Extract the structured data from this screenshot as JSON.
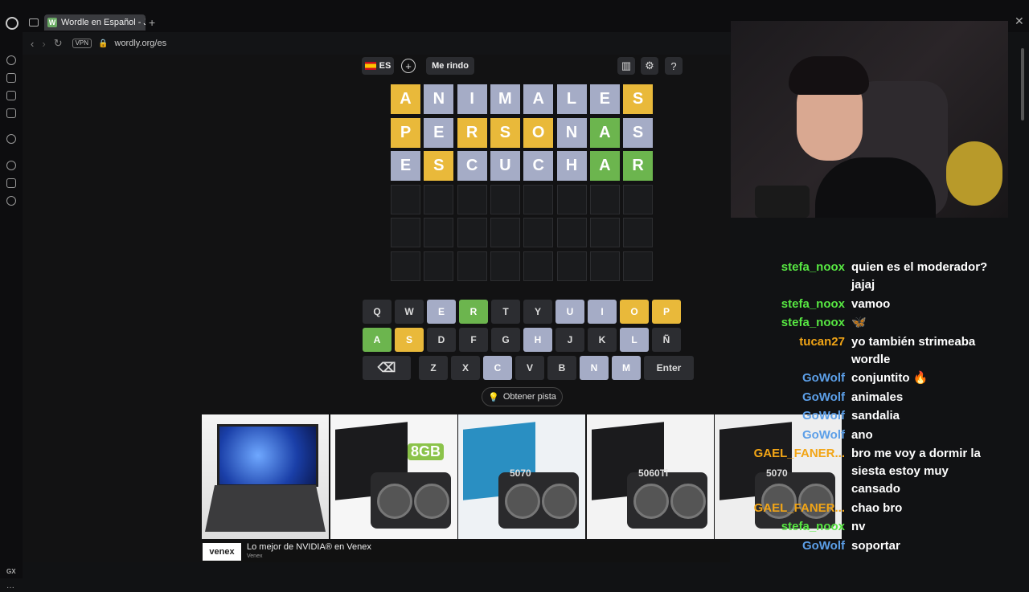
{
  "browser": {
    "tab_title": "Wordle en Español - Juego",
    "tab_favicon": "W",
    "url": "wordly.org/es",
    "vpn": "VPN",
    "sidebar_gx": "GX"
  },
  "header": {
    "language": "ES",
    "give_up": "Me rindo"
  },
  "colors": {
    "present": "#e9b93a",
    "correct": "#6cb54e",
    "absent": "#a5acc6"
  },
  "board": [
    [
      {
        "l": "A",
        "s": "present"
      },
      {
        "l": "N",
        "s": "absent"
      },
      {
        "l": "I",
        "s": "absent"
      },
      {
        "l": "M",
        "s": "absent"
      },
      {
        "l": "A",
        "s": "absent"
      },
      {
        "l": "L",
        "s": "absent"
      },
      {
        "l": "E",
        "s": "absent"
      },
      {
        "l": "S",
        "s": "present"
      }
    ],
    [
      {
        "l": "P",
        "s": "present"
      },
      {
        "l": "E",
        "s": "absent"
      },
      {
        "l": "R",
        "s": "present"
      },
      {
        "l": "S",
        "s": "present"
      },
      {
        "l": "O",
        "s": "present"
      },
      {
        "l": "N",
        "s": "absent"
      },
      {
        "l": "A",
        "s": "correct"
      },
      {
        "l": "S",
        "s": "absent"
      }
    ],
    [
      {
        "l": "E",
        "s": "absent"
      },
      {
        "l": "S",
        "s": "present"
      },
      {
        "l": "C",
        "s": "absent"
      },
      {
        "l": "U",
        "s": "absent"
      },
      {
        "l": "C",
        "s": "absent"
      },
      {
        "l": "H",
        "s": "absent"
      },
      {
        "l": "A",
        "s": "correct"
      },
      {
        "l": "R",
        "s": "correct"
      }
    ],
    [
      {
        "l": "",
        "s": "empty"
      },
      {
        "l": "",
        "s": "empty"
      },
      {
        "l": "",
        "s": "empty"
      },
      {
        "l": "",
        "s": "empty"
      },
      {
        "l": "",
        "s": "empty"
      },
      {
        "l": "",
        "s": "empty"
      },
      {
        "l": "",
        "s": "empty"
      },
      {
        "l": "",
        "s": "empty"
      }
    ],
    [
      {
        "l": "",
        "s": "empty"
      },
      {
        "l": "",
        "s": "empty"
      },
      {
        "l": "",
        "s": "empty"
      },
      {
        "l": "",
        "s": "empty"
      },
      {
        "l": "",
        "s": "empty"
      },
      {
        "l": "",
        "s": "empty"
      },
      {
        "l": "",
        "s": "empty"
      },
      {
        "l": "",
        "s": "empty"
      }
    ],
    [
      {
        "l": "",
        "s": "empty"
      },
      {
        "l": "",
        "s": "empty"
      },
      {
        "l": "",
        "s": "empty"
      },
      {
        "l": "",
        "s": "empty"
      },
      {
        "l": "",
        "s": "empty"
      },
      {
        "l": "",
        "s": "empty"
      },
      {
        "l": "",
        "s": "empty"
      },
      {
        "l": "",
        "s": "empty"
      }
    ]
  ],
  "keyboard": [
    [
      {
        "k": "Q",
        "s": ""
      },
      {
        "k": "W",
        "s": ""
      },
      {
        "k": "E",
        "s": "absent"
      },
      {
        "k": "R",
        "s": "correct"
      },
      {
        "k": "T",
        "s": ""
      },
      {
        "k": "Y",
        "s": ""
      },
      {
        "k": "U",
        "s": "absent"
      },
      {
        "k": "I",
        "s": "absent"
      },
      {
        "k": "O",
        "s": "present"
      },
      {
        "k": "P",
        "s": "present"
      }
    ],
    [
      {
        "k": "A",
        "s": "correct"
      },
      {
        "k": "S",
        "s": "present"
      },
      {
        "k": "D",
        "s": ""
      },
      {
        "k": "F",
        "s": ""
      },
      {
        "k": "G",
        "s": ""
      },
      {
        "k": "H",
        "s": "absent"
      },
      {
        "k": "J",
        "s": ""
      },
      {
        "k": "K",
        "s": ""
      },
      {
        "k": "L",
        "s": "absent"
      },
      {
        "k": "Ñ",
        "s": ""
      }
    ],
    [
      {
        "k": "⌫",
        "s": "",
        "wide": true
      },
      {
        "k": "Z",
        "s": ""
      },
      {
        "k": "X",
        "s": ""
      },
      {
        "k": "C",
        "s": "absent"
      },
      {
        "k": "V",
        "s": ""
      },
      {
        "k": "B",
        "s": ""
      },
      {
        "k": "N",
        "s": "absent"
      },
      {
        "k": "M",
        "s": "absent"
      },
      {
        "k": "Enter",
        "s": "",
        "wide": true
      }
    ]
  ],
  "hint_button": "Obtener pista",
  "ad": {
    "brand": "venex",
    "title": "Lo mejor de NVIDIA® en Venex",
    "subtitle": "Venex",
    "products": [
      {
        "badge": ""
      },
      {
        "badge": "8GB"
      },
      {
        "badge": "5070"
      },
      {
        "badge": "5060Ti"
      },
      {
        "badge": "5070"
      }
    ]
  },
  "chat": [
    {
      "user": "stefa_noox",
      "color": "#57e642",
      "lines": [
        "quien es el moderador?",
        "jajaj"
      ]
    },
    {
      "user": "stefa_noox",
      "color": "#57e642",
      "lines": [
        "vamoo"
      ]
    },
    {
      "user": "stefa_noox",
      "color": "#57e642",
      "lines": [
        "🦋"
      ]
    },
    {
      "user": "tucan27",
      "color": "#f2a516",
      "lines": [
        "yo también strimeaba",
        "wordle"
      ]
    },
    {
      "user": "GoWolf",
      "color": "#5c9fe8",
      "lines": [
        "conjuntito 🔥"
      ]
    },
    {
      "user": "GoWolf",
      "color": "#5c9fe8",
      "lines": [
        "animales"
      ]
    },
    {
      "user": "GoWolf",
      "color": "#5c9fe8",
      "lines": [
        "sandalia"
      ]
    },
    {
      "user": "GoWolf",
      "color": "#5c9fe8",
      "lines": [
        "ano"
      ]
    },
    {
      "user": "GAEL_FANER...",
      "color": "#f2a516",
      "lines": [
        "bro me voy a dormir la",
        "siesta estoy muy",
        "cansado"
      ]
    },
    {
      "user": "GAEL_FANER...",
      "color": "#f2a516",
      "lines": [
        "chao bro"
      ]
    },
    {
      "user": "stefa_noox",
      "color": "#57e642",
      "lines": [
        "nv"
      ]
    },
    {
      "user": "GoWolf",
      "color": "#5c9fe8",
      "lines": [
        "soportar"
      ]
    }
  ]
}
